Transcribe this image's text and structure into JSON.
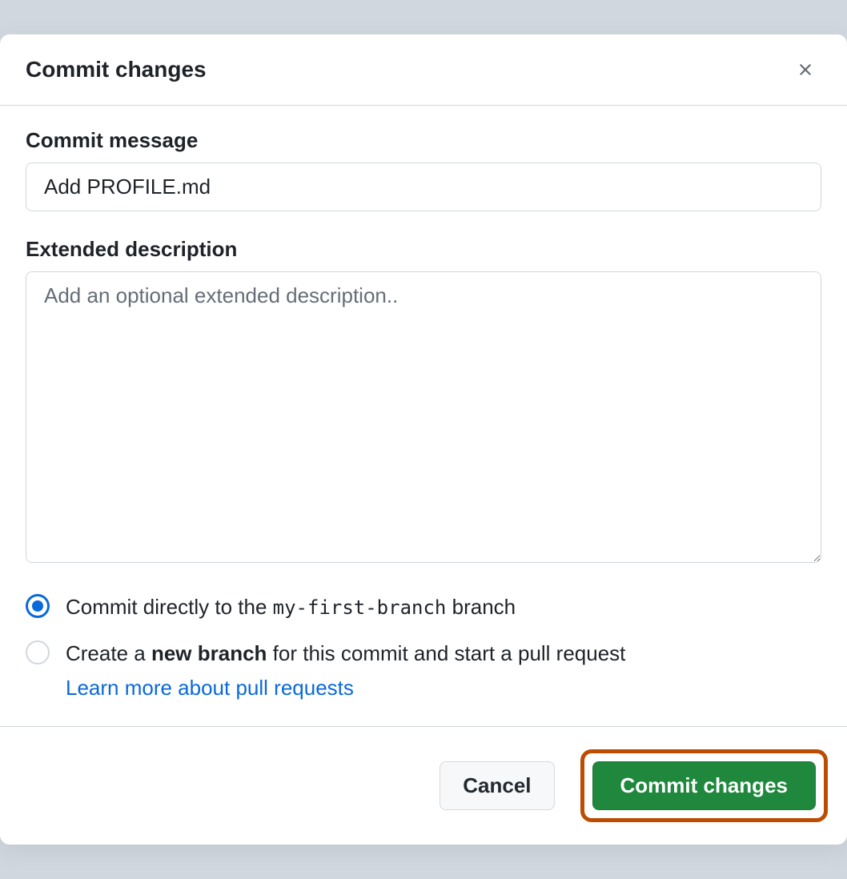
{
  "dialog": {
    "title": "Commit changes"
  },
  "commit_message": {
    "label": "Commit message",
    "value": "Add PROFILE.md"
  },
  "extended_description": {
    "label": "Extended description",
    "placeholder": "Add an optional extended description.."
  },
  "branch_options": {
    "direct_prefix": "Commit directly to the ",
    "direct_branch": "my-first-branch",
    "direct_suffix": " branch",
    "new_branch_prefix": "Create a ",
    "new_branch_bold": "new branch",
    "new_branch_suffix": " for this commit and start a pull request",
    "learn_more": "Learn more about pull requests"
  },
  "footer": {
    "cancel_label": "Cancel",
    "commit_label": "Commit changes"
  }
}
